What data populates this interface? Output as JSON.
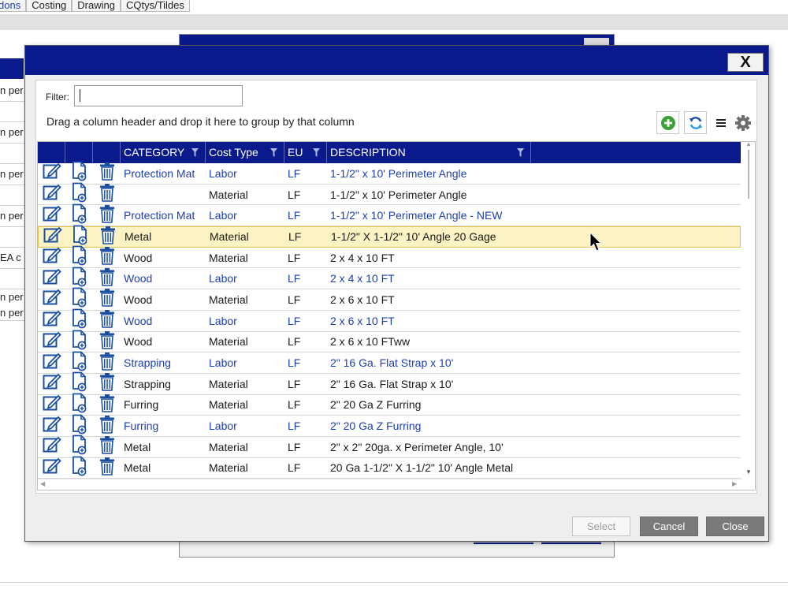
{
  "background": {
    "tabs": [
      "dons",
      "Costing",
      "Drawing",
      "CQtys/Tildes"
    ],
    "left_rows": [
      "n per",
      "n per",
      "n per",
      "n per",
      "EA c",
      "n per",
      "n per"
    ]
  },
  "dialog": {
    "close_glyph": "X",
    "filter": {
      "label": "Filter:",
      "value": ""
    },
    "group_hint": "Drag a column header and drop it here to group by that column",
    "toolbar": {
      "add_icon": "plus-circle-icon",
      "refresh_icon": "refresh-icon",
      "menu_icon": "hamburger-menu-icon",
      "settings_icon": "gear-icon"
    },
    "grid": {
      "columns": [
        "CATEGORY",
        "Cost Type",
        "EU",
        "DESCRIPTION"
      ],
      "rows": [
        {
          "category": "Protection Mat",
          "cost_type": "Labor",
          "eu": "LF",
          "description": "1-1/2\" x 10' Perimeter Angle",
          "style": "blue"
        },
        {
          "category": "",
          "cost_type": "Material",
          "eu": "LF",
          "description": "1-1/2\" x 10' Perimeter Angle",
          "style": "normal"
        },
        {
          "category": "Protection Mat",
          "cost_type": "Labor",
          "eu": "LF",
          "description": "1-1/2\" x 10' Perimeter Angle - NEW",
          "style": "blue"
        },
        {
          "category": "Metal",
          "cost_type": "Material",
          "eu": "LF",
          "description": "1-1/2\" X 1-1/2\" 10' Angle 20 Gage",
          "style": "selected"
        },
        {
          "category": "Wood",
          "cost_type": "Material",
          "eu": "LF",
          "description": "2 x 4 x 10 FT",
          "style": "normal"
        },
        {
          "category": "Wood",
          "cost_type": "Labor",
          "eu": "LF",
          "description": "2 x 4 x 10 FT",
          "style": "blue"
        },
        {
          "category": "Wood",
          "cost_type": "Material",
          "eu": "LF",
          "description": "2 x 6 x 10 FT",
          "style": "normal"
        },
        {
          "category": "Wood",
          "cost_type": "Labor",
          "eu": "LF",
          "description": "2 x 6 x 10 FT",
          "style": "blue"
        },
        {
          "category": "Wood",
          "cost_type": "Material",
          "eu": "LF",
          "description": "2 x 6 x 10 FTww",
          "style": "normal"
        },
        {
          "category": "Strapping",
          "cost_type": "Labor",
          "eu": "LF",
          "description": "2\" 16 Ga. Flat Strap x 10'",
          "style": "blue"
        },
        {
          "category": "Strapping",
          "cost_type": "Material",
          "eu": "LF",
          "description": "2\" 16 Ga. Flat Strap x 10'",
          "style": "normal"
        },
        {
          "category": "Furring",
          "cost_type": "Material",
          "eu": "LF",
          "description": "2\" 20 Ga Z Furring",
          "style": "normal"
        },
        {
          "category": "Furring",
          "cost_type": "Labor",
          "eu": "LF",
          "description": "2\" 20 Ga Z Furring",
          "style": "blue"
        },
        {
          "category": "Metal",
          "cost_type": "Material",
          "eu": "LF",
          "description": "2\" x 2\" 20ga. x Perimeter Angle, 10'",
          "style": "normal"
        },
        {
          "category": "Metal",
          "cost_type": "Material",
          "eu": "LF",
          "description": "20 Ga 1-1/2\" X 1-1/2\" 10' Angle Metal",
          "style": "normal"
        }
      ]
    },
    "buttons": {
      "select": "Select",
      "cancel": "Cancel",
      "close": "Close"
    }
  },
  "colors": {
    "navy": "#0a1a8c",
    "link_blue": "#1e3fae",
    "selected_row": "#fbf3c4",
    "icon_blue": "#1a4fa0",
    "add_green": "#3aa335"
  }
}
